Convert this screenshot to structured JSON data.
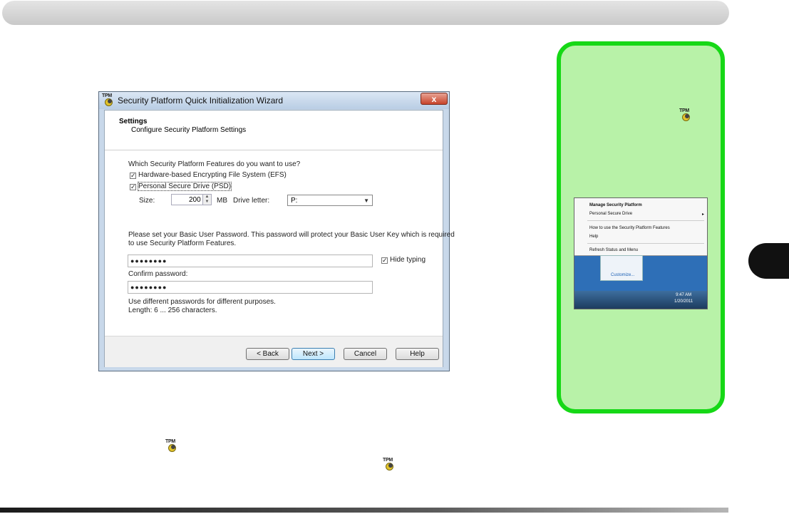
{
  "wizard": {
    "title": "Security Platform Quick Initialization Wizard",
    "close_label": "x",
    "header_title": "Settings",
    "header_subtitle": "Configure Security Platform Settings",
    "question": "Which Security Platform Features do you want to use?",
    "efs_label": "Hardware-based Encrypting File System (EFS)",
    "efs_checked": true,
    "psd_label": "Personal Secure Drive (PSD)",
    "psd_checked": true,
    "size_label": "Size:",
    "size_value": "200",
    "size_unit": "MB",
    "drive_letter_label": "Drive letter:",
    "drive_letter_value": "P:",
    "password_instructions_1": "Please set your Basic User Password. This password will protect your Basic User Key which is required",
    "password_instructions_2": "to use Security Platform Features.",
    "password_value": "●●●●●●●●",
    "hide_typing_label": "Hide typing",
    "hide_typing_checked": true,
    "confirm_label": "Confirm password:",
    "confirm_value": "●●●●●●●●",
    "hint_1": "Use different passwords for different purposes.",
    "hint_2": "Length: 6 ... 256 characters.",
    "buttons": {
      "back": "< Back",
      "next": "Next >",
      "cancel": "Cancel",
      "help": "Help"
    }
  },
  "tray_menu": {
    "items": [
      "Manage Security Platform",
      "Personal Secure Drive",
      "How to use the Security Platform Features",
      "Help",
      "Refresh Status and Menu"
    ],
    "customize_label": "Customize...",
    "clock_time": "9:47 AM",
    "clock_date": "1/20/2011"
  },
  "icons": {
    "tpm_text": "TPM"
  },
  "colors": {
    "sidebar_border": "#16d816",
    "sidebar_fill": "#b8f2a8",
    "chapter_tab": "#111111"
  }
}
